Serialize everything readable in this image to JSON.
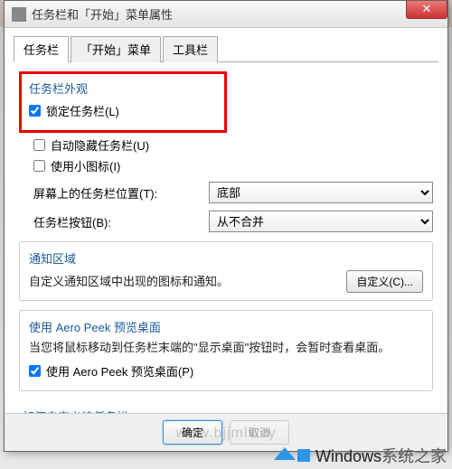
{
  "window": {
    "title": "任务栏和「开始」菜单属性"
  },
  "tabs": [
    {
      "label": "任务栏"
    },
    {
      "label": "「开始」菜单"
    },
    {
      "label": "工具栏"
    }
  ],
  "appearance": {
    "section_title": "任务栏外观",
    "lock_taskbar": {
      "label": "锁定任务栏(L)",
      "checked": true
    },
    "auto_hide": {
      "label": "自动隐藏任务栏(U)",
      "checked": false
    },
    "small_icons": {
      "label": "使用小图标(I)",
      "checked": false
    },
    "position": {
      "label": "屏幕上的任务栏位置(T):",
      "value": "底部"
    },
    "buttons": {
      "label": "任务栏按钮(B):",
      "value": "从不合并"
    }
  },
  "notification": {
    "title": "通知区域",
    "desc": "自定义通知区域中出现的图标和通知。",
    "customize_btn": "自定义(C)..."
  },
  "aero_peek": {
    "title": "使用 Aero Peek 预览桌面",
    "desc": "当您将鼠标移动到任务栏末端的\"显示桌面\"按钮时，会暂时查看桌面。",
    "checkbox": {
      "label": "使用 Aero Peek 预览桌面(P)",
      "checked": true
    }
  },
  "help_link": "如何自定义该任务栏?",
  "buttons_bar": {
    "ok": "确定",
    "cancel": "取消"
  },
  "watermark": {
    "brand": "Windows",
    "brand_suffix": "系统之家",
    "url": "www.bjjmlv.cy"
  }
}
